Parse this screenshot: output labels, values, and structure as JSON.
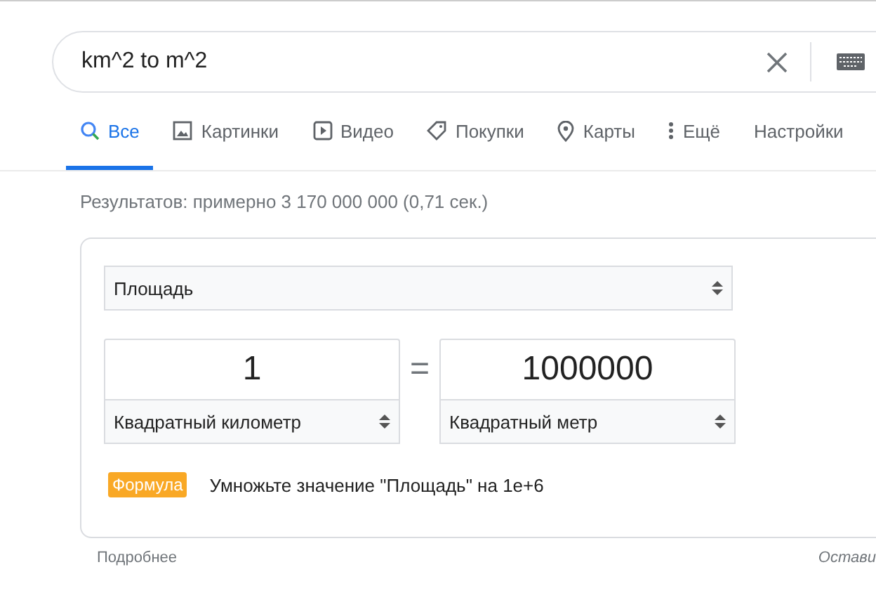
{
  "search": {
    "value": "km^2 to m^2"
  },
  "tabs": [
    {
      "label": "Все",
      "kind": "search",
      "selected": true
    },
    {
      "label": "Картинки",
      "kind": "image",
      "selected": false
    },
    {
      "label": "Видео",
      "kind": "video",
      "selected": false
    },
    {
      "label": "Покупки",
      "kind": "tag",
      "selected": false
    },
    {
      "label": "Карты",
      "kind": "pin",
      "selected": false
    },
    {
      "label": "Ещё",
      "kind": "more",
      "selected": false
    },
    {
      "label": "Настройки",
      "kind": "plain",
      "selected": false
    }
  ],
  "result_stats": "Результатов: примерно 3 170 000 000 (0,71 сек.)",
  "converter": {
    "quantity": "Площадь",
    "from": {
      "value": "1",
      "unit": "Квадратный километр"
    },
    "equals": "=",
    "to": {
      "value": "1000000",
      "unit": "Квадратный метр"
    },
    "formula_badge": "Формула",
    "formula": "Умножьте значение \"Площадь\" на 1e+6"
  },
  "footer": {
    "more": "Подробнее",
    "feedback": "Остави"
  }
}
